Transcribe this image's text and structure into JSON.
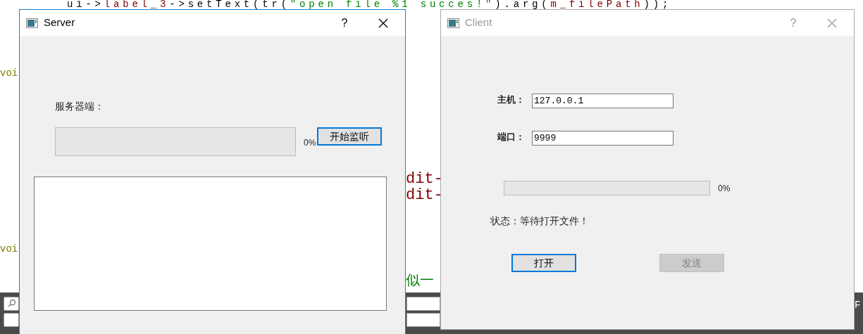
{
  "editor": {
    "code_line": [
      {
        "text": "ui->",
        "color": "#000000"
      },
      {
        "text": "label_3",
        "color": "#800000"
      },
      {
        "text": "->setText(tr(",
        "color": "#000000"
      },
      {
        "text": "\"open file %1 succes!\"",
        "color": "#008000"
      },
      {
        "text": ").arg(",
        "color": "#000000"
      },
      {
        "text": "m_filePath",
        "color": "#800000"
      },
      {
        "text": "));",
        "color": "#000000"
      }
    ],
    "left_fragments": [
      {
        "text": "voi",
        "color": "#808000"
      },
      {
        "text": "voi",
        "color": "#808000"
      }
    ],
    "middle_fragments": [
      {
        "text": "dit-",
        "color": "#800000"
      },
      {
        "text": "dit-",
        "color": "#800000"
      },
      {
        "text": "似一",
        "color": "#008000"
      }
    ],
    "right_fragment": "F"
  },
  "server": {
    "title": "Server",
    "active": true,
    "help": "?",
    "label": "服务器端：",
    "progress": {
      "level": 0,
      "reading": "0%"
    },
    "button": {
      "label": "开始监听",
      "focused": true,
      "disabled": false
    }
  },
  "client": {
    "title": "Client",
    "active": false,
    "help": "?",
    "fields": [
      {
        "label": "主机：",
        "value": "127.0.0.1"
      },
      {
        "label": "端口：",
        "value": "9999"
      }
    ],
    "progress": {
      "level": 0,
      "reading": "0%"
    },
    "status": "状态：等待打开文件！",
    "buttons": [
      {
        "label": "打开",
        "focused": true,
        "disabled": false
      },
      {
        "label": "发送",
        "focused": false,
        "disabled": true
      }
    ]
  }
}
